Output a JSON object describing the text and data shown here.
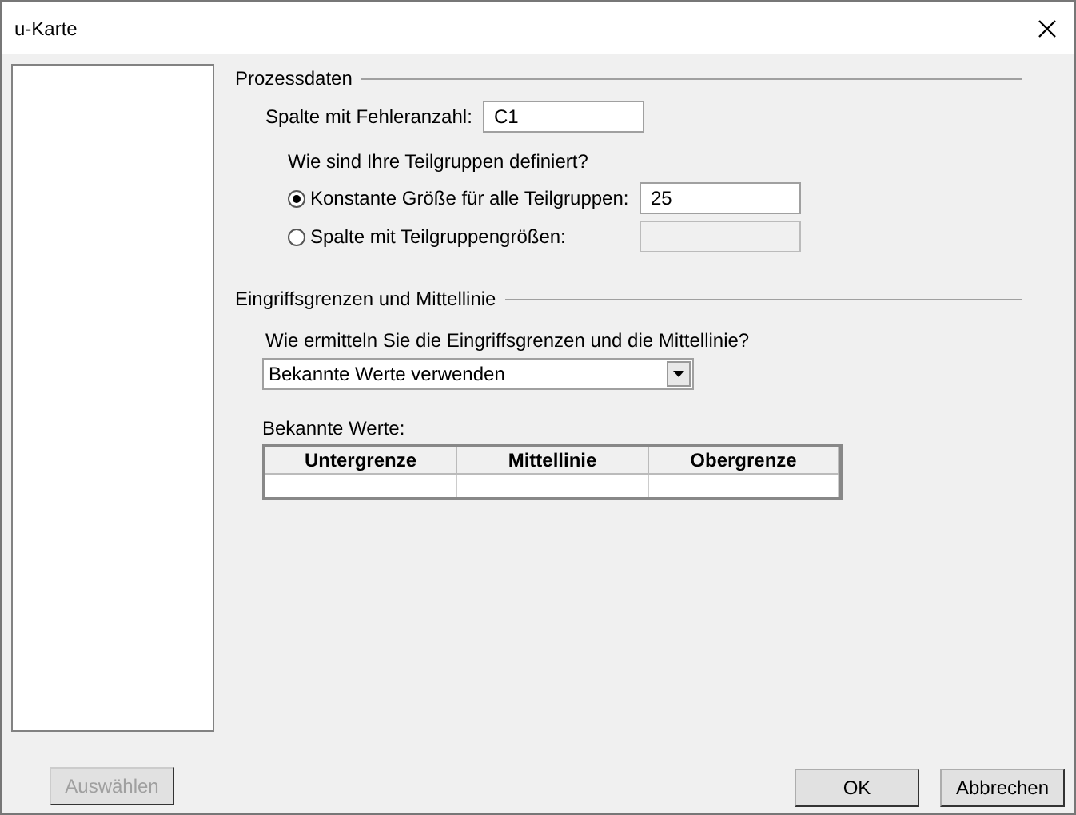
{
  "window": {
    "title": "u-Karte"
  },
  "select_button": {
    "label": "Auswählen",
    "disabled": true
  },
  "process_data": {
    "title": "Prozessdaten",
    "defect_column": {
      "label": "Spalte mit Fehleranzahl:",
      "value": "C1"
    },
    "subgroup_question": "Wie sind Ihre Teilgruppen definiert?",
    "subgroup_options": [
      {
        "label": "Konstante Größe für alle Teilgruppen:",
        "selected": true,
        "value": "25",
        "disabled": false
      },
      {
        "label": "Spalte mit Teilgruppengrößen:",
        "selected": false,
        "disabled": true
      }
    ]
  },
  "control_limits": {
    "title": "Eingriffsgrenzen und Mittellinie",
    "method_question": "Wie ermitteln Sie die Eingriffsgrenzen und die Mittellinie?",
    "method": "Bekannte Werte verwenden",
    "known_values_label": "Bekannte Werte:",
    "table": {
      "columns": [
        "Untergrenze",
        "Mittellinie",
        "Obergrenze"
      ]
    }
  },
  "buttons": [
    {
      "label": "OK",
      "disabled": false
    },
    {
      "label": "Abbrechen",
      "disabled": false
    }
  ]
}
